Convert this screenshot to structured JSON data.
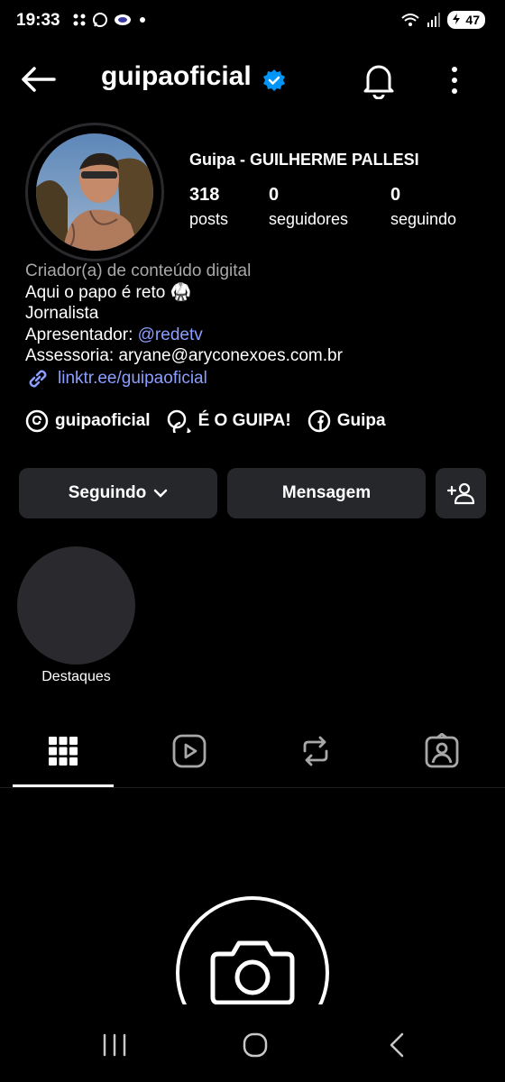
{
  "status_bar": {
    "time": "19:33",
    "battery": "47",
    "icons": [
      "grid-dots-icon",
      "whatsapp-icon",
      "app-icon",
      "dot-icon",
      "wifi-icon",
      "signal-icon",
      "battery-icon"
    ]
  },
  "header": {
    "username": "guipaoficial",
    "verified": true
  },
  "profile": {
    "full_name": "Guipa - GUILHERME PALLESI",
    "stats": [
      {
        "value": "318",
        "label": "posts"
      },
      {
        "value": "0",
        "label": "seguidores"
      },
      {
        "value": "0",
        "label": "seguindo"
      }
    ],
    "category": "Criador(a) de conteúdo digital",
    "bio_line1": "Aqui o papo é reto 🥋",
    "bio_line2": "Jornalista",
    "bio_line3_prefix": "Apresentador: ",
    "bio_line3_mention": "@redetv",
    "bio_line4": "Assessoria: aryane@aryconexoes.com.br",
    "link": "linktr.ee/guipaoficial"
  },
  "social": [
    {
      "icon": "threads-icon",
      "label": "guipaoficial"
    },
    {
      "icon": "chat-icon",
      "label": "É O GUIPA!"
    },
    {
      "icon": "facebook-icon",
      "label": "Guipa"
    }
  ],
  "buttons": {
    "following": "Seguindo",
    "message": "Mensagem"
  },
  "highlights": [
    {
      "label": "Destaques"
    }
  ],
  "tabs": [
    "grid-icon",
    "reels-icon",
    "reposts-icon",
    "tagged-icon"
  ],
  "colors": {
    "background": "#000000",
    "button": "#26272b",
    "link": "#8c9eff",
    "verified": "#0095f6"
  }
}
